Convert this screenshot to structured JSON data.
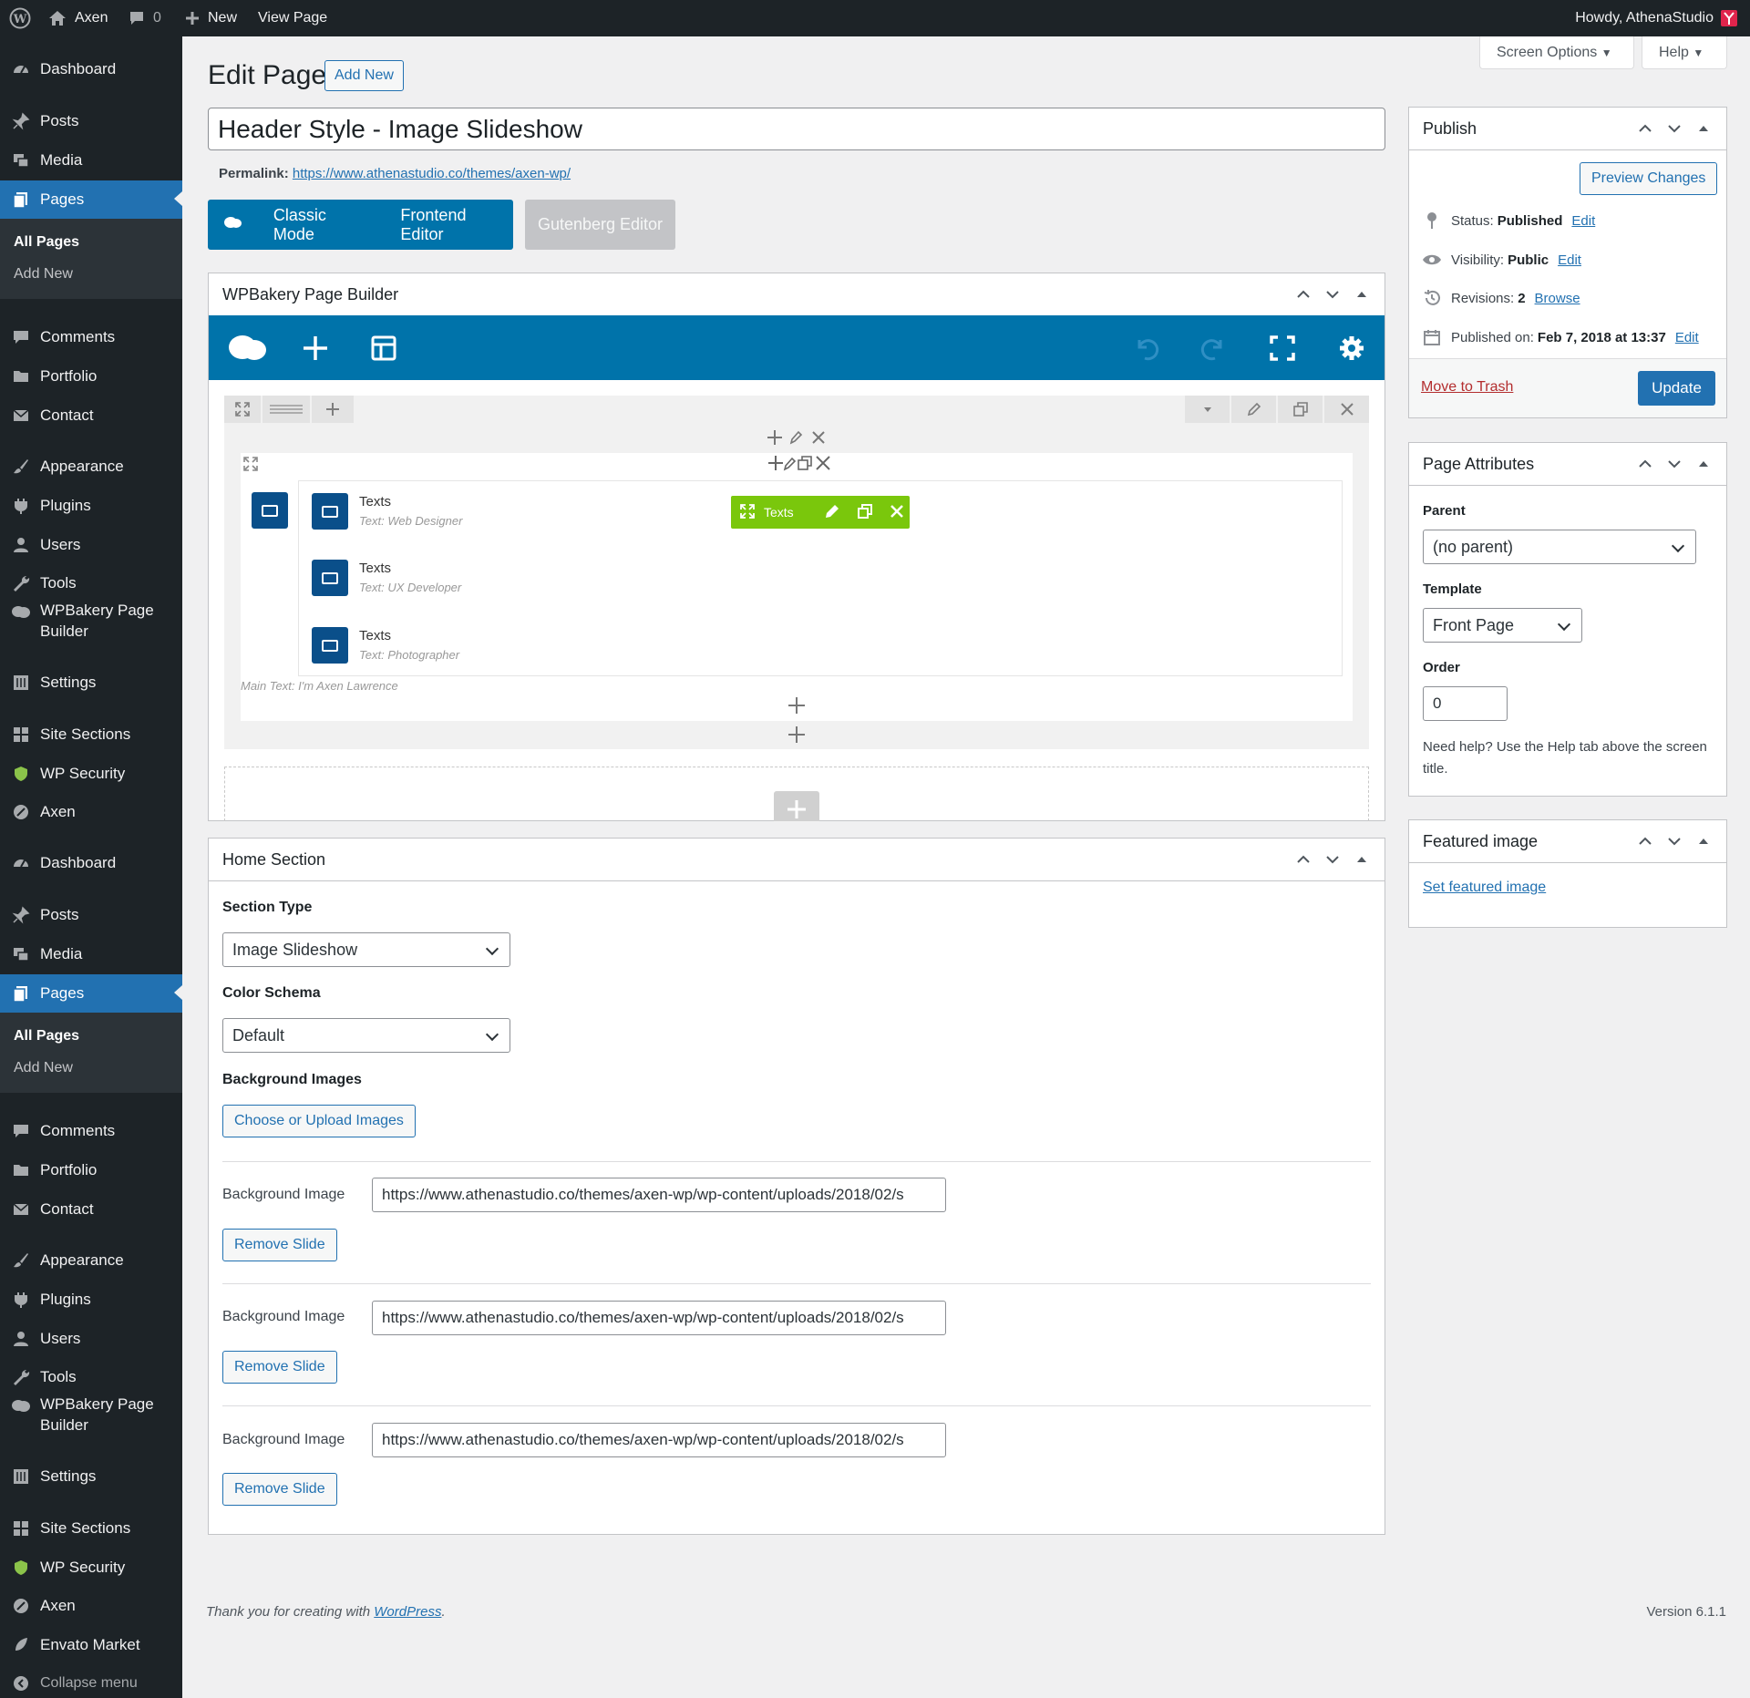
{
  "adminbar": {
    "site_name": "Axen",
    "comments_count": "0",
    "new_label": "New",
    "view_page": "View Page",
    "howdy": "Howdy, AthenaStudio"
  },
  "sidebar": {
    "group1": {
      "dashboard": "Dashboard",
      "posts": "Posts",
      "media": "Media",
      "pages": "Pages",
      "sub_all_pages": "All Pages",
      "sub_add_new": "Add New",
      "comments": "Comments",
      "portfolio": "Portfolio",
      "contact": "Contact",
      "appearance": "Appearance",
      "plugins": "Plugins",
      "users": "Users",
      "tools": "Tools",
      "wpbakery": "WPBakery Page Builder",
      "settings": "Settings",
      "site_sections": "Site Sections",
      "wp_security": "WP Security",
      "axen": "Axen"
    },
    "group2": {
      "dashboard": "Dashboard",
      "posts": "Posts",
      "media": "Media",
      "pages": "Pages",
      "sub_all_pages": "All Pages",
      "sub_add_new": "Add New",
      "comments": "Comments",
      "portfolio": "Portfolio",
      "contact": "Contact",
      "appearance": "Appearance",
      "plugins": "Plugins",
      "users": "Users",
      "tools": "Tools",
      "wpbakery": "WPBakery Page Builder",
      "settings": "Settings",
      "site_sections": "Site Sections",
      "wp_security": "WP Security",
      "axen": "Axen",
      "envato": "Envato Market",
      "collapse": "Collapse menu"
    }
  },
  "page": {
    "title": "Edit Page",
    "add_new": "Add New",
    "screen_options": "Screen Options",
    "help": "Help",
    "post_title": "Header Style - Image Slideshow",
    "permalink_label": "Permalink:",
    "permalink_url": "https://www.athenastudio.co/themes/axen-wp/"
  },
  "modes": {
    "classic": "Classic Mode",
    "frontend": "Frontend Editor",
    "gutenberg": "Gutenberg Editor"
  },
  "wpbakery": {
    "box_title": "WPBakery Page Builder",
    "green_label": "Texts",
    "elements": [
      {
        "title": "Texts",
        "sub": "Text: Web Designer"
      },
      {
        "title": "Texts",
        "sub": "Text: UX Developer"
      },
      {
        "title": "Texts",
        "sub": "Text: Photographer"
      }
    ],
    "main_text": "Main Text: I'm Axen Lawrence"
  },
  "home_section": {
    "title": "Home Section",
    "section_type_label": "Section Type",
    "section_type_value": "Image Slideshow",
    "color_schema_label": "Color Schema",
    "color_schema_value": "Default",
    "bg_images_label": "Background Images",
    "choose_button": "Choose or Upload Images",
    "slides": [
      {
        "label": "Background Image",
        "value": "https://www.athenastudio.co/themes/axen-wp/wp-content/uploads/2018/02/s",
        "remove": "Remove Slide"
      },
      {
        "label": "Background Image",
        "value": "https://www.athenastudio.co/themes/axen-wp/wp-content/uploads/2018/02/s",
        "remove": "Remove Slide"
      },
      {
        "label": "Background Image",
        "value": "https://www.athenastudio.co/themes/axen-wp/wp-content/uploads/2018/02/s",
        "remove": "Remove Slide"
      }
    ]
  },
  "publish": {
    "title": "Publish",
    "preview": "Preview Changes",
    "status_label": "Status:",
    "status_value": "Published",
    "visibility_label": "Visibility:",
    "visibility_value": "Public",
    "revisions_label": "Revisions:",
    "revisions_value": "2",
    "browse": "Browse",
    "published_label": "Published on:",
    "published_value": "Feb 7, 2018 at 13:37",
    "edit": "Edit",
    "trash": "Move to Trash",
    "update": "Update"
  },
  "attributes": {
    "title": "Page Attributes",
    "parent_label": "Parent",
    "parent_value": "(no parent)",
    "template_label": "Template",
    "template_value": "Front Page",
    "order_label": "Order",
    "order_value": "0",
    "help_text": "Need help? Use the Help tab above the screen title."
  },
  "featured": {
    "title": "Featured image",
    "link": "Set featured image"
  },
  "footer": {
    "thanks": "Thank you for creating with",
    "wp_link": "WordPress",
    "version": "Version 6.1.1"
  },
  "colors": {
    "admin_dark": "#1d2327",
    "wp_blue": "#2271b1",
    "vc_blue": "#0073aa",
    "vc_green": "#7ac70c"
  }
}
